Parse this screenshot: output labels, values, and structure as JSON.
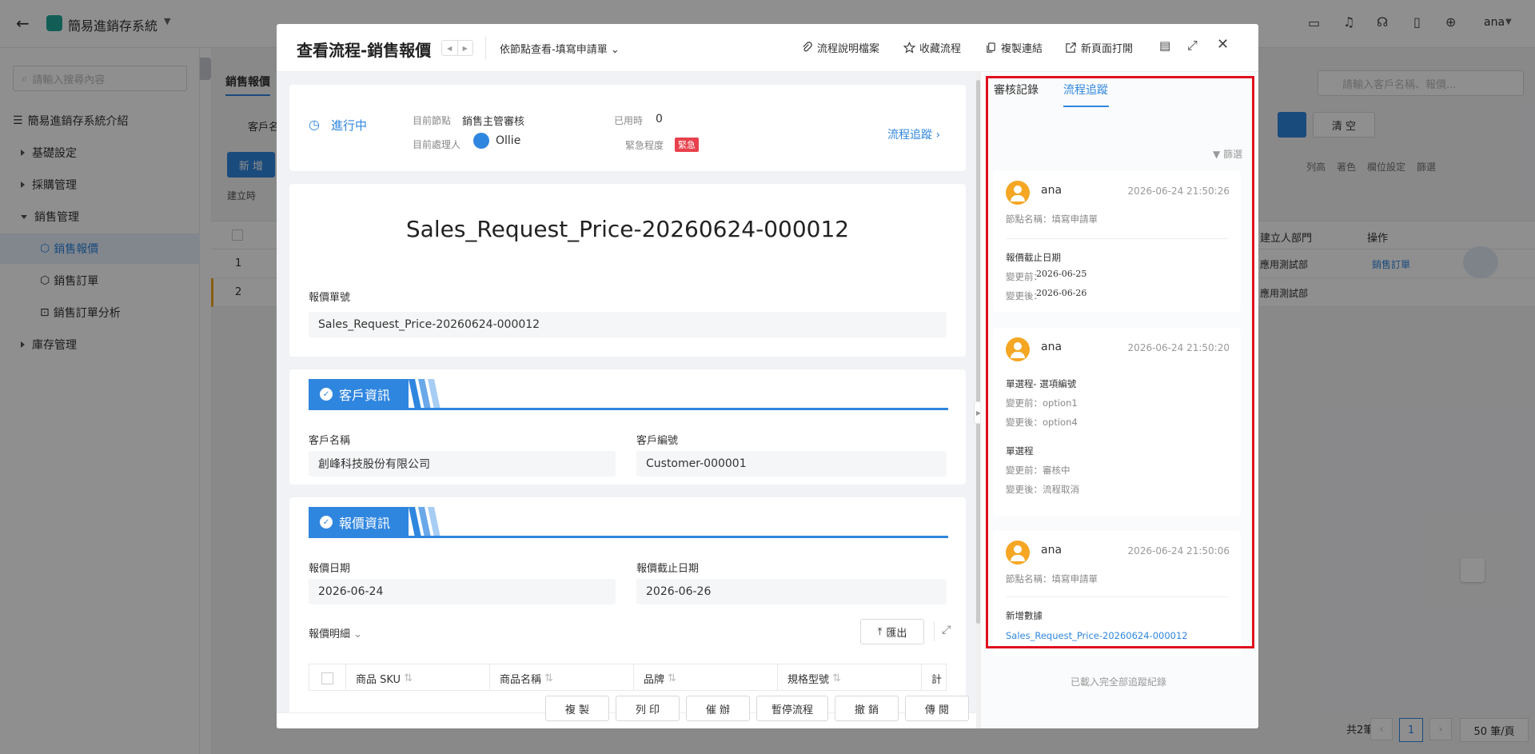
{
  "app": {
    "title": "簡易進銷存系統",
    "user": "ana",
    "search_placeholder": "請輸入搜尋內容"
  },
  "sidebar": {
    "items": [
      {
        "label": "簡易進銷存系統介紹"
      },
      {
        "label": "基礎設定"
      },
      {
        "label": "採購管理"
      },
      {
        "label": "銷售管理"
      },
      {
        "label": "銷售報價"
      },
      {
        "label": "銷售訂單"
      },
      {
        "label": "銷售訂單分析"
      },
      {
        "label": "庫存管理"
      }
    ]
  },
  "background": {
    "tab": "銷售報價",
    "filter_label": "客戶名",
    "search_placeholder": "請輸入客戶名稱、報價...",
    "clear_label": "清 空",
    "new_label": "新 增",
    "created_label": "建立時",
    "toolbar": [
      "列高",
      "著色",
      "欄位設定",
      "篩選"
    ],
    "headers": {
      "dept": "建立人部門",
      "op": "操作"
    },
    "rows": [
      {
        "idx": "1",
        "dept": "應用測試部",
        "op": "銷售訂單"
      },
      {
        "idx": "2",
        "dept": "應用測試部",
        "op": ""
      }
    ],
    "total": "共2筆",
    "page": "1",
    "page_size": "50 筆/頁"
  },
  "modal": {
    "title": "查看流程-銷售報價",
    "node_view": "依節點查看-填寫申請單",
    "tools": {
      "doc": "流程說明檔案",
      "fav": "收藏流程",
      "copy": "複製連結",
      "newpage": "新頁面打開"
    },
    "status": {
      "state": "進行中",
      "current_node_label": "目前節點",
      "current_node": "銷售主管審核",
      "handler_label": "目前處理人",
      "handler": "Ollie",
      "used_time_label": "已用時",
      "used_time": "0",
      "urgency_label": "緊急程度",
      "urgency": "緊急",
      "trace_link": "流程追蹤"
    },
    "doc_title": "Sales_Request_Price-20260624-000012",
    "quote_no_label": "報價單號",
    "quote_no": "Sales_Request_Price-20260624-000012",
    "customer_section": "客戶資訊",
    "customer_name_label": "客戶名稱",
    "customer_name": "創峰科技股份有限公司",
    "customer_no_label": "客戶編號",
    "customer_no": "Customer-000001",
    "quote_section": "報價資訊",
    "quote_date_label": "報價日期",
    "quote_date": "2026-06-24",
    "quote_deadline_label": "報價截止日期",
    "quote_deadline": "2026-06-26",
    "detail_label": "報價明細",
    "export_label": "匯出",
    "table_headers": [
      "商品 SKU",
      "商品名稱",
      "品牌",
      "規格型號",
      "計"
    ],
    "footer_buttons": [
      "複 製",
      "列 印",
      "催 辦",
      "暫停流程",
      "撤 銷",
      "傳 閱"
    ]
  },
  "trace": {
    "tabs": [
      "審核記錄",
      "流程追蹤"
    ],
    "filter": "篩選",
    "logs": [
      {
        "user": "ana",
        "time": "2026-06-24 21:50:26",
        "node": "節點名稱：填寫申請單",
        "field": "報價截止日期",
        "before": "變更前：",
        "before_val": "2026-06-25",
        "after": "變更後：",
        "after_val": "2026-06-26"
      },
      {
        "user": "ana",
        "time": "2026-06-24 21:50:20",
        "field1": "單選程- 選項編號",
        "before1": "變更前：option1",
        "after1": "變更後：option4",
        "field2": "單選程",
        "before2": "變更前：審核中",
        "after2": "變更後：流程取消"
      },
      {
        "user": "ana",
        "time": "2026-06-24 21:50:06",
        "node": "節點名稱：填寫申請單",
        "field": "新增數據",
        "link": "Sales_Request_Price-20260624-000012"
      }
    ],
    "loaded_all": "已載入完全部追蹤紀錄"
  },
  "colors": {
    "accent": "#2f86df",
    "urgent": "#e8414d",
    "highlight": "#e0101e",
    "avatar": "#f5a623"
  }
}
